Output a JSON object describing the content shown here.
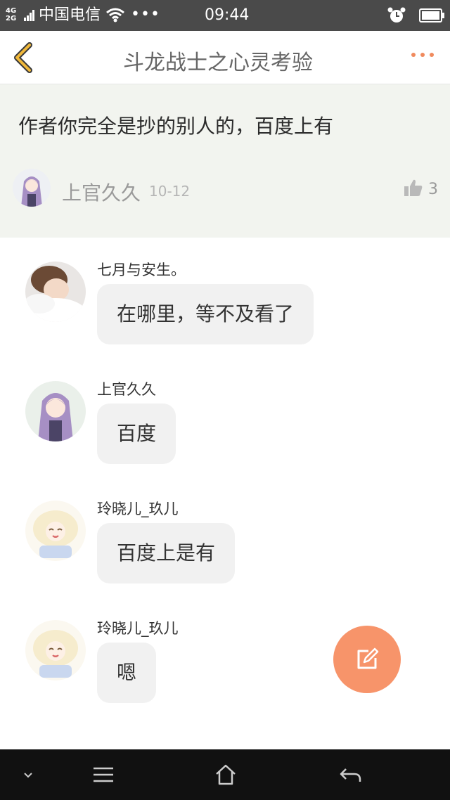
{
  "status_bar": {
    "network_top": "4G",
    "network_bottom": "2G",
    "carrier": "中国电信",
    "more": "•••",
    "time": "09:44",
    "icons": [
      "signal-icon",
      "wifi-icon",
      "alarm-icon",
      "battery-icon"
    ]
  },
  "header": {
    "title": "斗龙战士之心灵考验",
    "icons": [
      "back-arrow-icon",
      "more-dots-icon"
    ],
    "accent_color": "#f0a030",
    "more_color": "#f08a5d"
  },
  "post": {
    "content": "作者你完全是抄的别人的，百度上有",
    "author": "上官久久",
    "date": "10-12",
    "likes": "3"
  },
  "replies": [
    {
      "name": "七月与安生。",
      "text": "在哪里，等不及看了"
    },
    {
      "name": "上官久久",
      "text": "百度"
    },
    {
      "name": "玲晓儿_玖儿",
      "text": "百度上是有"
    },
    {
      "name": "玲晓儿_玖儿",
      "text": "嗯"
    }
  ],
  "fab": {
    "icon": "compose-icon",
    "color": "#f7946a"
  },
  "nav_bar": {
    "icons": [
      "chevron-down-icon",
      "menu-icon",
      "home-icon",
      "back-icon"
    ]
  }
}
